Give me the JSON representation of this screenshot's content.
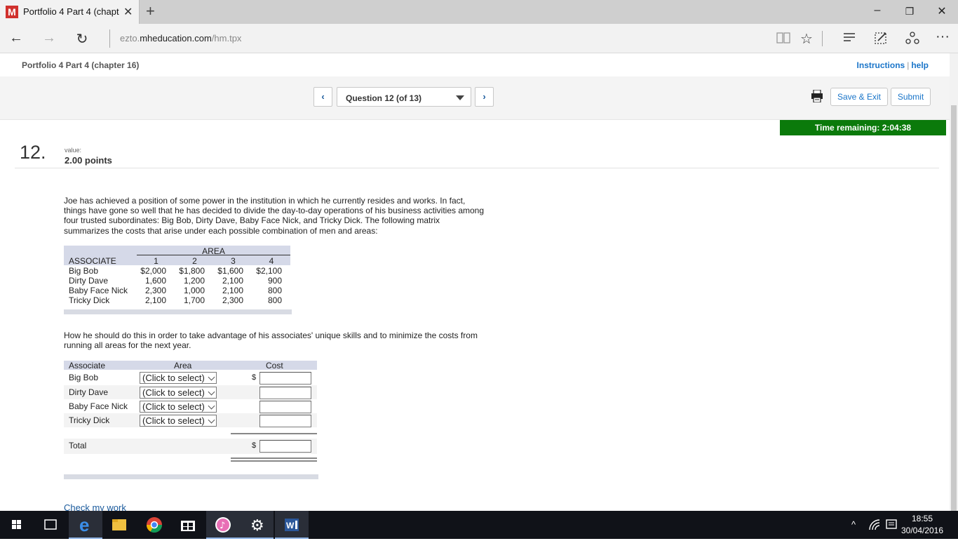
{
  "browser": {
    "tab_title": "Portfolio 4 Part 4 (chapt",
    "tab_logo": "M",
    "new_tab": "+",
    "address_prefix": "ezto.",
    "address_host": "mheducation.com",
    "address_path": "/hm.tpx",
    "more_label": "···"
  },
  "header": {
    "assignment_title": "Portfolio 4 Part 4 (chapter 16)",
    "instructions_link": "Instructions",
    "help_link": "help",
    "link_sep": "|"
  },
  "question_nav": {
    "prev_label": "‹",
    "next_label": "›",
    "current": "Question 12 (of 13)",
    "save_exit": "Save & Exit",
    "submit": "Submit"
  },
  "timer": "Time remaining: 2:04:38",
  "question": {
    "number": "12.",
    "value_label": "value:",
    "points": "2.00 points",
    "problem_text": "Joe has achieved a position of some power in the institution in which he currently resides and works. In fact, things have gone so well that he has decided to divide the day-to-day operations of his business activities among four trusted subordinates: Big Bob, Dirty Dave, Baby Face Nick, and Tricky Dick. The following matrix summarizes the costs that arise under each possible combination of men and areas:",
    "instruction_text": "How he should do this in order to take advantage of his associates' unique skills and to minimize the costs from running all areas for the next year."
  },
  "matrix": {
    "group_header": "AREA",
    "row_header": "ASSOCIATE",
    "columns": [
      "1",
      "2",
      "3",
      "4"
    ],
    "rows": [
      {
        "name": "Big Bob",
        "values": [
          "$2,000",
          "$1,800",
          "$1,600",
          "$2,100"
        ]
      },
      {
        "name": "Dirty Dave",
        "values": [
          "1,600",
          "1,200",
          "2,100",
          "900"
        ]
      },
      {
        "name": "Baby Face Nick",
        "values": [
          "2,300",
          "1,000",
          "2,100",
          "800"
        ]
      },
      {
        "name": "Tricky Dick",
        "values": [
          "2,100",
          "1,700",
          "2,300",
          "800"
        ]
      }
    ]
  },
  "answer_table": {
    "headers": {
      "associate": "Associate",
      "area": "Area",
      "cost": "Cost"
    },
    "rows": [
      {
        "name": "Big Bob",
        "select": "(Click to select)",
        "dollar": "$"
      },
      {
        "name": "Dirty Dave",
        "select": "(Click to select)",
        "dollar": ""
      },
      {
        "name": "Baby Face Nick",
        "select": "(Click to select)",
        "dollar": ""
      },
      {
        "name": "Tricky Dick",
        "select": "(Click to select)",
        "dollar": ""
      }
    ],
    "total_label": "Total",
    "total_dollar": "$"
  },
  "check_work": "Check my work",
  "taskbar": {
    "time": "18:55",
    "date": "30/04/2016"
  }
}
